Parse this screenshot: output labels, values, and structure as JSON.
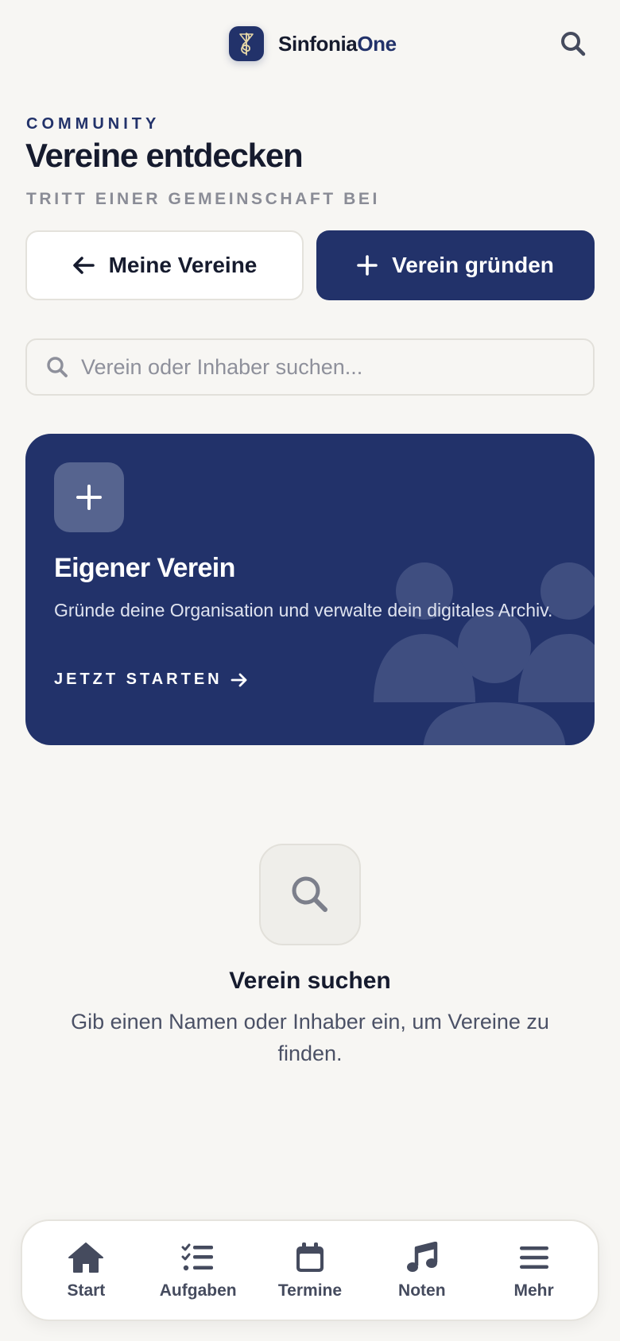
{
  "header": {
    "brand_main": "Sinfonia",
    "brand_accent": "One"
  },
  "intro": {
    "eyebrow": "COMMUNITY",
    "title": "Vereine entdecken",
    "subtitle": "TRITT EINER GEMEINSCHAFT BEI"
  },
  "actions": {
    "my_clubs_label": "Meine Vereine",
    "create_club_label": "Verein gründen"
  },
  "search": {
    "placeholder": "Verein oder Inhaber suchen...",
    "value": ""
  },
  "promo": {
    "title": "Eigener Verein",
    "text": "Gründe deine Organisation und verwalte dein digitales Archiv.",
    "cta": "JETZT STARTEN"
  },
  "empty_state": {
    "title": "Verein suchen",
    "text": "Gib einen Namen oder Inhaber ein, um Vereine zu finden."
  },
  "nav": {
    "items": [
      {
        "label": "Start",
        "icon": "home-icon"
      },
      {
        "label": "Aufgaben",
        "icon": "task-list-icon"
      },
      {
        "label": "Termine",
        "icon": "calendar-icon"
      },
      {
        "label": "Noten",
        "icon": "music-note-icon"
      },
      {
        "label": "Mehr",
        "icon": "menu-icon"
      }
    ]
  },
  "colors": {
    "brand": "#22326a",
    "background": "#f7f6f3",
    "text": "#161b2e",
    "muted": "#8a8c96"
  }
}
